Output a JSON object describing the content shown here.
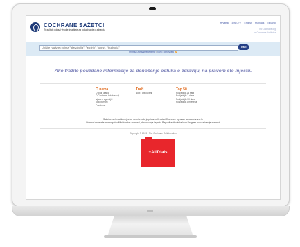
{
  "site": {
    "title": "COCHRANE SAŽETCI",
    "subtitle": "Rezultati dokazi visoke kvalitete za odlučivanje o zdravlju"
  },
  "languages": [
    "Hrvatski",
    "简体中文",
    "English",
    "Français",
    "Español"
  ],
  "side_links": [
    "na Cochrane.org",
    "na Cochrane Knjižnica"
  ],
  "search": {
    "placeholder": "Upišite naziv(e) pojma \"glavobolja\", \"aspirin\", \"ugriz\", \"trudnoća\"",
    "button": "Traži",
    "links": {
      "advanced": "Pretraži zdravstvene teme",
      "separator": "|",
      "browse": "Novi i obnovljeni",
      "help": "?"
    }
  },
  "tagline": "Ako tražite pouzdane informacije za donošenje odluka o zdravlju, na pravom ste mjestu.",
  "columns": [
    {
      "heading": "O nama",
      "items": [
        "O ovoj stranici",
        "O Cochrane kolaboraciji",
        "Izjava o agenciji i odgovornost",
        "Privatnost"
      ]
    },
    {
      "heading": "Traži",
      "items": [
        "Novi i obnovljeni"
      ]
    },
    {
      "heading": "Top 50",
      "items": [
        "Posljednja 24 sata",
        "Posljednjih 7 dana",
        "Posljednjih 30 dana",
        "Posljednja 3 mjeseca"
      ]
    }
  ],
  "info_lines": [
    "Sažetke na hrvatskom jeziku na prijevodu je pridonio Hrvatski Cochrane ogranak www.cochrane.hr",
    "Prijevod sažetaka je omogućilo Ministarstvo znanosti, obrazovanja i sporta Republike Hrvatske kroz Program popularizacije znanosti"
  ],
  "copyright": "Copyright © 2013 - The Cochrane Collaboration",
  "badge": {
    "label": "+AllTrials"
  },
  "colors": {
    "brand_navy": "#1e3a78",
    "accent_orange": "#e06b1f",
    "search_band": "#dceaf5",
    "alltrials_red": "#e8262c"
  }
}
